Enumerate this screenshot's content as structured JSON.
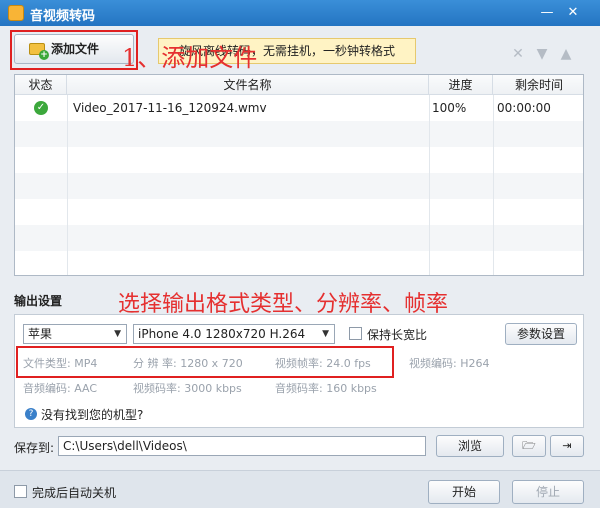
{
  "window": {
    "title": "音视频转码",
    "minimize_glyph": "—",
    "close_glyph": "✕"
  },
  "toolbar": {
    "add_file_label": "添加文件",
    "annotation_1": "1、添加文件",
    "tip": "旋风离线转码，无需挂机，一秒钟转格式",
    "icons": [
      "close-icon",
      "arrow-down-icon",
      "arrow-up-icon"
    ]
  },
  "file_table": {
    "columns": [
      "状态",
      "文件名称",
      "进度",
      "剩余时间"
    ],
    "rows": [
      {
        "status": "done",
        "name": "Video_2017-11-16_120924.wmv",
        "progress": "100%",
        "remaining": "00:00:00"
      }
    ]
  },
  "settings": {
    "title": "输出设置",
    "annotation_2": "选择输出格式类型、分辨率、帧率",
    "device": "苹果",
    "preset": "iPhone 4.0 1280x720 H.264",
    "keep_ratio_label": "保持长宽比",
    "params_button": "参数设置",
    "params": {
      "file_type": "文件类型:  MP4",
      "resolution": "分 辨 率:  1280 x 720",
      "frame_rate": "视频帧率:  24.0 fps",
      "video_codec": "视频编码:  H264",
      "audio_codec": "音频编码:  AAC",
      "video_bitrate": "视频码率:  3000 kbps",
      "audio_bitrate": "音频码率:  160 kbps"
    },
    "help_text": "没有找到您的机型?"
  },
  "save": {
    "label": "保存到:",
    "path": "C:\\Users\\dell\\Videos\\",
    "browse_label": "浏览"
  },
  "footer": {
    "auto_shutdown_label": "完成后自动关机",
    "start_label": "开始",
    "stop_label": "停止"
  },
  "colors": {
    "title_bar": "#2474c2",
    "annotation": "#e53030",
    "tip_background": "#fff3c4",
    "success": "#3ca83c"
  }
}
